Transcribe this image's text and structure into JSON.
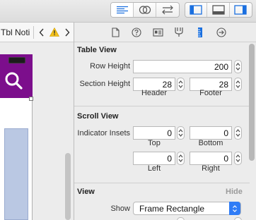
{
  "toolbar": {
    "editor_group": [
      {
        "name": "standard-editor",
        "icon": "align-left-lines-icon",
        "active": true
      },
      {
        "name": "assistant-editor",
        "icon": "venn-circles-icon",
        "active": false
      },
      {
        "name": "version-editor",
        "icon": "swap-arrows-icon",
        "active": false
      }
    ],
    "view_group": [
      {
        "name": "navigator-toggle",
        "icon": "left-panel-icon"
      },
      {
        "name": "debug-toggle",
        "icon": "bottom-panel-icon"
      },
      {
        "name": "utilities-toggle",
        "icon": "right-panel-icon"
      }
    ],
    "accent": "#1a6fdf"
  },
  "jumpbar": {
    "title": "Tbl Noti",
    "back_icon": "chevron-left-icon",
    "warning_icon": "warning-icon",
    "forward_icon": "chevron-right-icon"
  },
  "canvas": {
    "nav_color": "#7c0e8c",
    "table_color": "#bac8e3"
  },
  "inspector": {
    "tabs": [
      {
        "name": "file",
        "icon": "document-icon"
      },
      {
        "name": "help",
        "icon": "question-icon"
      },
      {
        "name": "identity",
        "icon": "identity-card-icon"
      },
      {
        "name": "attributes",
        "icon": "attributes-icon"
      },
      {
        "name": "size",
        "icon": "ruler-icon",
        "active": true
      },
      {
        "name": "connections",
        "icon": "arrow-circle-icon"
      }
    ],
    "table_view": {
      "title": "Table View",
      "row_height_label": "Row Height",
      "row_height": "200",
      "section_height_label": "Section Height",
      "header_value": "28",
      "footer_value": "28",
      "header_label": "Header",
      "footer_label": "Footer"
    },
    "scroll_view": {
      "title": "Scroll View",
      "insets_label": "Indicator Insets",
      "top_value": "0",
      "bottom_value": "0",
      "left_value": "0",
      "right_value": "0",
      "top_label": "Top",
      "bottom_label": "Bottom",
      "left_label": "Left",
      "right_label": "Right"
    },
    "view": {
      "title": "View",
      "hide_label": "Hide",
      "show_label": "Show",
      "show_value": "Frame Rectangle"
    }
  }
}
